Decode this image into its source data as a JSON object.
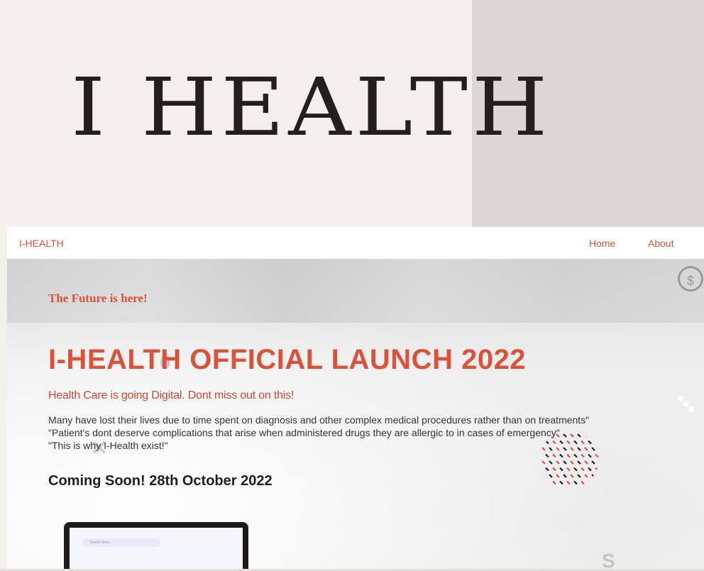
{
  "logo": {
    "text": "I HEALTH"
  },
  "nav": {
    "brand": "I-HEALTH",
    "links": [
      "Home",
      "About"
    ]
  },
  "hero": {
    "tagline": "The Future is here!",
    "headline": "I-HEALTH OFFICIAL LAUNCH 2022",
    "subhead": "Health Care is going Digital. Dont miss out on this!",
    "body": [
      "Many have lost their lives due to time spent on diagnosis and other complex medical procedures rather than on treatments\"",
      "\"Patient's dont deserve complications that arise when administered drugs they are allergic to in cases of emergency\"",
      "\"This is why I-Health exist!\""
    ],
    "coming_soon": "Coming Soon! 28th October 2022",
    "laptop_search_placeholder": "Search here..."
  },
  "colors": {
    "accent": "#d9533a",
    "logo": "#231f1c",
    "left_bg": "#f3f0ec",
    "right_bg": "#dcd7d2"
  }
}
